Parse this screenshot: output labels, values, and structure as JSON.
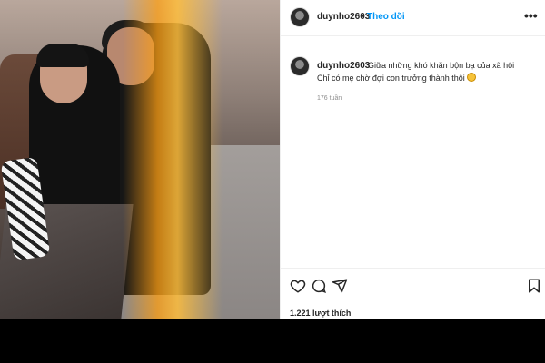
{
  "post": {
    "author": {
      "username": "duynho2603",
      "avatar_icon": "profile-avatar"
    },
    "header": {
      "separator": "•",
      "follow_label": "Theo dõi",
      "more_icon": "more-options-icon"
    },
    "caption": {
      "username": "duynho2603",
      "line1": "Giữa những khó khăn bộn bạ của xã hội",
      "line2": "Chỉ có mẹ chờ đợi con trưởng thành thôi",
      "emoji_icon": "smiling-face-emoji",
      "age": "176 tuần"
    },
    "actions": {
      "like_icon": "heart-icon",
      "comment_icon": "comment-icon",
      "share_icon": "send-icon",
      "save_icon": "bookmark-icon"
    },
    "likes_text": "1.221 lượt thích"
  },
  "colors": {
    "link_blue": "#0095f6",
    "text": "#262626",
    "muted": "#8e8e8e"
  }
}
